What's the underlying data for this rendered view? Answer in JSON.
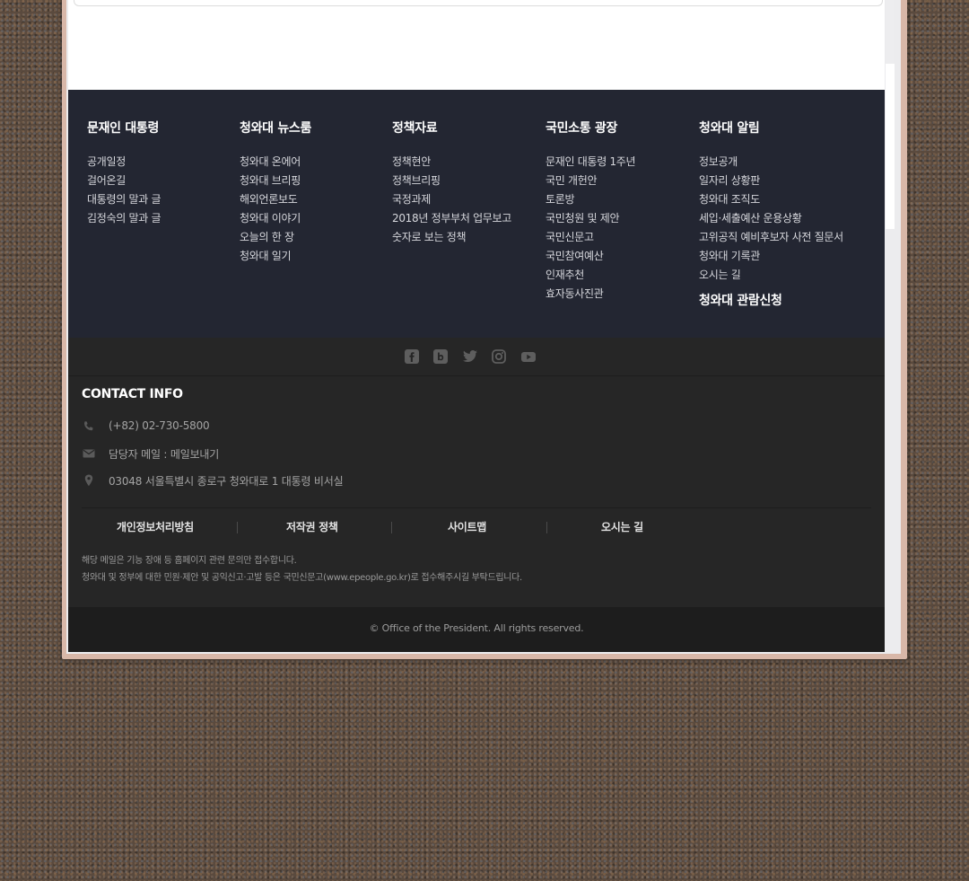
{
  "sitemap": {
    "columns": [
      {
        "title": "문재인 대통령",
        "items": [
          "공개일정",
          "걸어온길",
          "대통령의 말과 글",
          "김정숙의 말과 글"
        ]
      },
      {
        "title": "청와대 뉴스룸",
        "items": [
          "청와대 온에어",
          "청와대 브리핑",
          "해외언론보도",
          "청와대 이야기",
          "오늘의 한 장",
          "청와대 일기"
        ]
      },
      {
        "title": "정책자료",
        "items": [
          "정책현안",
          "정책브리핑",
          "국정과제",
          "2018년 정부부처 업무보고",
          "숫자로 보는 정책"
        ]
      },
      {
        "title": "국민소통 광장",
        "items": [
          "문재인 대통령 1주년",
          "국민 개헌안",
          "토론방",
          "국민청원 및 제안",
          "국민신문고",
          "국민참여예산",
          "인재추천",
          "효자동사진관"
        ]
      },
      {
        "title": "청와대 알림",
        "items": [
          "정보공개",
          "일자리 상황판",
          "청와대 조직도",
          "세입·세출예산 운용상황",
          "고위공직 예비후보자 사전 질문서",
          "청와대 기록관",
          "오시는 길"
        ],
        "extra": "청와대 관람신청"
      }
    ]
  },
  "social": {
    "icons": [
      "facebook-icon",
      "blog-icon",
      "twitter-icon",
      "instagram-icon",
      "youtube-icon"
    ],
    "icon_color": "#5e5e5e"
  },
  "contact": {
    "title": "CONTACT INFO",
    "phone": "(+82) 02-730-5800",
    "email": "담당자 메일 : 메일보내기",
    "address": "03048 서울특별시 종로구 청와대로 1 대통령 비서실"
  },
  "footer_links": [
    "개인정보처리방침",
    "저작권 정책",
    "사이트맵",
    "오시는 길"
  ],
  "notices": [
    "해당 메일은 기능 장애 등 홈페이지 관련 문의만 접수합니다.",
    "청와대 및 정부에 대한 민원·제안 및 공익신고·고발 등은 국민신문고(www.epeople.go.kr)로 접수해주시길 부탁드립니다."
  ],
  "copyright": "© Office of the President. All rights reserved.",
  "colors": {
    "sitemap_bg": "#232632",
    "footer_bg": "#262626",
    "copyright_bg": "#1d1d1d",
    "frame": "#d8b7a8"
  }
}
